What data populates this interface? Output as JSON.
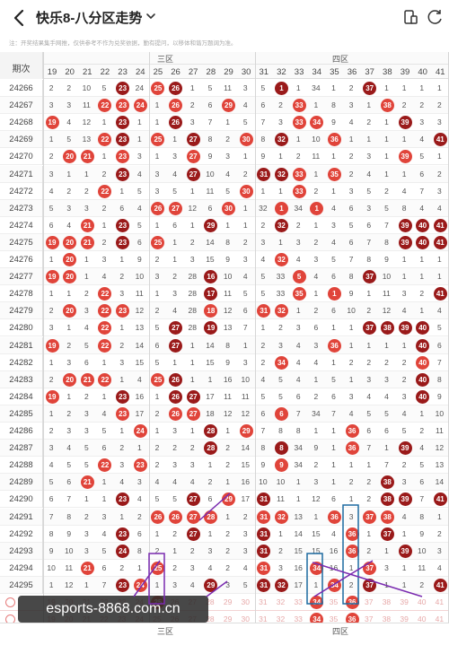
{
  "header": {
    "title": "快乐8-八分区走势",
    "back_icon": "chevron-left-icon",
    "dropdown_icon": "chevron-down-icon",
    "right_icons": [
      "device-icon",
      "share-icon"
    ]
  },
  "notice": "注：开奖结果集手网推，仅供参考不作为兑奖依据，勤有提问，以移体和谐万题阔为准。",
  "table": {
    "period_header": "期次",
    "zones": {
      "top_left": "三区",
      "top_right": "四区",
      "bottom_left": "三区",
      "bottom_right": "四区"
    },
    "columns": [
      "19",
      "20",
      "21",
      "22",
      "23",
      "24",
      "25",
      "26",
      "27",
      "28",
      "29",
      "30",
      "31",
      "32",
      "33",
      "34",
      "35",
      "36",
      "37",
      "38",
      "39",
      "40",
      "41"
    ],
    "rows": [
      {
        "p": "24266",
        "v": [
          "2",
          "2",
          "10",
          "5",
          "23",
          "24",
          "25",
          "26",
          "1",
          "5",
          "11",
          "3",
          "5",
          "1",
          "1",
          "34",
          "1",
          "2",
          "37",
          "1",
          "1",
          "1",
          "1"
        ],
        "b": [
          4,
          6,
          7,
          13,
          18
        ]
      },
      {
        "p": "24267",
        "v": [
          "3",
          "3",
          "11",
          "22",
          "23",
          "24",
          "1",
          "26",
          "2",
          "6",
          "29",
          "4",
          "6",
          "2",
          "33",
          "1",
          "8",
          "3",
          "1",
          "38",
          "2",
          "2",
          "2"
        ],
        "b": [
          3,
          4,
          5,
          7,
          10,
          14,
          19
        ]
      },
      {
        "p": "24268",
        "v": [
          "19",
          "4",
          "12",
          "1",
          "23",
          "1",
          "1",
          "26",
          "3",
          "7",
          "1",
          "5",
          "7",
          "3",
          "33",
          "34",
          "9",
          "4",
          "2",
          "1",
          "39",
          "3",
          "3"
        ],
        "b": [
          0,
          4,
          7,
          14,
          15,
          20
        ]
      },
      {
        "p": "24269",
        "v": [
          "1",
          "5",
          "13",
          "22",
          "23",
          "1",
          "25",
          "1",
          "27",
          "8",
          "2",
          "30",
          "8",
          "32",
          "1",
          "10",
          "36",
          "1",
          "1",
          "1",
          "1",
          "4",
          "41"
        ],
        "b": [
          3,
          4,
          6,
          8,
          11,
          13,
          16,
          22
        ]
      },
      {
        "p": "24270",
        "v": [
          "2",
          "20",
          "21",
          "1",
          "23",
          "3",
          "1",
          "3",
          "27",
          "9",
          "3",
          "1",
          "9",
          "1",
          "2",
          "11",
          "1",
          "2",
          "3",
          "1",
          "39",
          "5",
          "1"
        ],
        "b": [
          1,
          2,
          4,
          8,
          20
        ]
      },
      {
        "p": "24271",
        "v": [
          "3",
          "1",
          "1",
          "2",
          "23",
          "4",
          "3",
          "4",
          "27",
          "10",
          "4",
          "2",
          "31",
          "32",
          "33",
          "1",
          "35",
          "2",
          "4",
          "1",
          "1",
          "6",
          "2"
        ],
        "b": [
          4,
          8,
          12,
          13,
          14,
          16
        ]
      },
      {
        "p": "24272",
        "v": [
          "4",
          "2",
          "2",
          "22",
          "1",
          "5",
          "3",
          "5",
          "1",
          "11",
          "5",
          "30",
          "1",
          "1",
          "33",
          "2",
          "1",
          "3",
          "5",
          "2",
          "4",
          "7",
          "3"
        ],
        "b": [
          3,
          11,
          14
        ]
      },
      {
        "p": "24273",
        "v": [
          "5",
          "3",
          "3",
          "2",
          "6",
          "4",
          "26",
          "27",
          "12",
          "6",
          "30",
          "1",
          "32",
          "1",
          "34",
          "1",
          "4",
          "6",
          "3",
          "5",
          "8",
          "4",
          "4"
        ],
        "b": [
          6,
          7,
          10,
          13,
          15
        ]
      },
      {
        "p": "24274",
        "v": [
          "6",
          "4",
          "21",
          "1",
          "23",
          "5",
          "1",
          "6",
          "1",
          "29",
          "1",
          "1",
          "2",
          "32",
          "2",
          "1",
          "3",
          "5",
          "6",
          "7",
          "39",
          "40",
          "41"
        ],
        "b": [
          2,
          4,
          9,
          13,
          20,
          21,
          22
        ]
      },
      {
        "p": "24275",
        "v": [
          "19",
          "20",
          "21",
          "2",
          "23",
          "6",
          "25",
          "1",
          "2",
          "14",
          "8",
          "2",
          "3",
          "1",
          "3",
          "2",
          "4",
          "6",
          "7",
          "8",
          "39",
          "40",
          "41"
        ],
        "b": [
          0,
          1,
          2,
          4,
          6,
          20,
          21,
          22
        ]
      },
      {
        "p": "24276",
        "v": [
          "1",
          "20",
          "1",
          "3",
          "1",
          "9",
          "2",
          "1",
          "3",
          "15",
          "9",
          "3",
          "4",
          "32",
          "4",
          "3",
          "5",
          "7",
          "8",
          "9",
          "1",
          "1",
          "1"
        ],
        "b": [
          1,
          13
        ]
      },
      {
        "p": "24277",
        "v": [
          "19",
          "20",
          "1",
          "4",
          "2",
          "10",
          "3",
          "2",
          "28",
          "16",
          "10",
          "4",
          "5",
          "33",
          "5",
          "4",
          "6",
          "8",
          "37",
          "10",
          "1",
          "1",
          "1"
        ],
        "b": [
          0,
          1,
          9,
          14,
          18
        ]
      },
      {
        "p": "24278",
        "v": [
          "1",
          "1",
          "2",
          "22",
          "3",
          "11",
          "1",
          "3",
          "28",
          "17",
          "11",
          "5",
          "5",
          "33",
          "35",
          "1",
          "1",
          "9",
          "1",
          "11",
          "3",
          "2",
          "41"
        ],
        "b": [
          3,
          9,
          14,
          16,
          22
        ]
      },
      {
        "p": "24279",
        "v": [
          "2",
          "20",
          "3",
          "22",
          "23",
          "12",
          "2",
          "4",
          "28",
          "18",
          "12",
          "6",
          "31",
          "32",
          "1",
          "2",
          "6",
          "10",
          "2",
          "12",
          "4",
          "1",
          "4"
        ],
        "b": [
          1,
          3,
          4,
          9,
          12,
          13
        ]
      },
      {
        "p": "24280",
        "v": [
          "3",
          "1",
          "4",
          "22",
          "1",
          "13",
          "5",
          "27",
          "28",
          "19",
          "13",
          "7",
          "1",
          "2",
          "3",
          "6",
          "1",
          "1",
          "37",
          "38",
          "39",
          "40",
          "5"
        ],
        "b": [
          3,
          7,
          9,
          18,
          19,
          20,
          21
        ]
      },
      {
        "p": "24281",
        "v": [
          "19",
          "2",
          "5",
          "22",
          "2",
          "14",
          "6",
          "27",
          "1",
          "14",
          "8",
          "1",
          "2",
          "3",
          "4",
          "3",
          "36",
          "1",
          "1",
          "1",
          "1",
          "40",
          "6"
        ],
        "b": [
          0,
          3,
          7,
          16,
          21
        ]
      },
      {
        "p": "24282",
        "v": [
          "1",
          "3",
          "6",
          "1",
          "3",
          "15",
          "5",
          "1",
          "1",
          "15",
          "9",
          "3",
          "2",
          "34",
          "4",
          "4",
          "1",
          "2",
          "2",
          "2",
          "2",
          "40",
          "7"
        ],
        "b": [
          13,
          21
        ]
      },
      {
        "p": "24283",
        "v": [
          "2",
          "20",
          "21",
          "22",
          "1",
          "4",
          "25",
          "26",
          "1",
          "1",
          "16",
          "10",
          "4",
          "5",
          "4",
          "1",
          "5",
          "1",
          "3",
          "3",
          "2",
          "40",
          "8"
        ],
        "b": [
          1,
          2,
          3,
          6,
          7,
          21
        ]
      },
      {
        "p": "24284",
        "v": [
          "19",
          "1",
          "2",
          "1",
          "23",
          "16",
          "1",
          "26",
          "27",
          "17",
          "11",
          "11",
          "5",
          "5",
          "6",
          "2",
          "6",
          "3",
          "4",
          "4",
          "3",
          "40",
          "9"
        ],
        "b": [
          0,
          4,
          7,
          8,
          21
        ]
      },
      {
        "p": "24285",
        "v": [
          "1",
          "2",
          "3",
          "4",
          "23",
          "17",
          "2",
          "26",
          "27",
          "18",
          "12",
          "12",
          "6",
          "6",
          "7",
          "34",
          "7",
          "4",
          "5",
          "5",
          "4",
          "1",
          "10"
        ],
        "b": [
          4,
          7,
          8,
          13
        ]
      },
      {
        "p": "24286",
        "v": [
          "2",
          "3",
          "3",
          "5",
          "1",
          "24",
          "1",
          "3",
          "1",
          "28",
          "1",
          "29",
          "7",
          "8",
          "8",
          "1",
          "1",
          "36",
          "6",
          "6",
          "5",
          "2",
          "11"
        ],
        "b": [
          5,
          9,
          11,
          17
        ]
      },
      {
        "p": "24287",
        "v": [
          "3",
          "4",
          "5",
          "6",
          "2",
          "1",
          "2",
          "2",
          "2",
          "28",
          "2",
          "14",
          "8",
          "8",
          "34",
          "9",
          "1",
          "36",
          "7",
          "1",
          "39",
          "4",
          "12"
        ],
        "b": [
          9,
          13,
          17,
          20
        ]
      },
      {
        "p": "24288",
        "v": [
          "4",
          "5",
          "5",
          "22",
          "3",
          "23",
          "2",
          "3",
          "3",
          "1",
          "2",
          "15",
          "9",
          "9",
          "34",
          "2",
          "1",
          "1",
          "1",
          "7",
          "2",
          "5",
          "13"
        ],
        "b": [
          3,
          5,
          13
        ]
      },
      {
        "p": "24289",
        "v": [
          "5",
          "6",
          "21",
          "1",
          "4",
          "3",
          "4",
          "4",
          "4",
          "2",
          "1",
          "16",
          "10",
          "10",
          "1",
          "3",
          "1",
          "2",
          "2",
          "38",
          "3",
          "6",
          "14"
        ],
        "b": [
          2,
          19
        ]
      },
      {
        "p": "24290",
        "v": [
          "6",
          "7",
          "1",
          "1",
          "23",
          "4",
          "5",
          "5",
          "27",
          "6",
          "29",
          "17",
          "31",
          "11",
          "1",
          "12",
          "6",
          "1",
          "2",
          "38",
          "39",
          "7",
          "41"
        ],
        "b": [
          4,
          8,
          10,
          12,
          19,
          20,
          22
        ]
      },
      {
        "p": "24291",
        "v": [
          "7",
          "8",
          "2",
          "3",
          "1",
          "2",
          "26",
          "26",
          "27",
          "28",
          "1",
          "2",
          "31",
          "32",
          "13",
          "1",
          "36",
          "3",
          "37",
          "38",
          "4",
          "8",
          "1"
        ],
        "b": [
          6,
          7,
          8,
          9,
          12,
          13,
          16,
          18,
          19
        ]
      },
      {
        "p": "24292",
        "v": [
          "8",
          "9",
          "3",
          "4",
          "23",
          "6",
          "1",
          "2",
          "27",
          "1",
          "2",
          "3",
          "31",
          "1",
          "14",
          "15",
          "4",
          "36",
          "1",
          "37",
          "1",
          "9",
          "2"
        ],
        "b": [
          4,
          8,
          12,
          17,
          19
        ]
      },
      {
        "p": "24293",
        "v": [
          "9",
          "10",
          "3",
          "5",
          "24",
          "8",
          "2",
          "1",
          "2",
          "3",
          "2",
          "3",
          "31",
          "2",
          "15",
          "15",
          "16",
          "36",
          "2",
          "1",
          "39",
          "10",
          "3"
        ],
        "b": [
          4,
          12,
          17,
          20
        ]
      },
      {
        "p": "24294",
        "v": [
          "10",
          "11",
          "21",
          "6",
          "2",
          "1",
          "25",
          "2",
          "3",
          "4",
          "2",
          "4",
          "31",
          "3",
          "16",
          "34",
          "16",
          "1",
          "37",
          "3",
          "1",
          "11",
          "4"
        ],
        "b": [
          2,
          6,
          12,
          15,
          18
        ]
      },
      {
        "p": "24295",
        "v": [
          "1",
          "12",
          "1",
          "7",
          "23",
          "24",
          "1",
          "3",
          "4",
          "29",
          "3",
          "5",
          "31",
          "32",
          "17",
          "1",
          "34",
          "2",
          "37",
          "1",
          "1",
          "2",
          "41"
        ],
        "b": [
          4,
          5,
          9,
          12,
          13,
          16,
          18,
          22
        ]
      }
    ],
    "placeholder_rows": [
      {
        "v": [
          "19",
          "20",
          "21",
          "22",
          "23",
          "24",
          "25",
          "26",
          "27",
          "28",
          "29",
          "30",
          "31",
          "32",
          "33",
          "34",
          "35",
          "36",
          "37",
          "38",
          "39",
          "40",
          "41"
        ],
        "b": [
          6,
          15,
          17
        ]
      },
      {
        "v": [
          "19",
          "20",
          "21",
          "22",
          "23",
          "24",
          "25",
          "26",
          "27",
          "28",
          "29",
          "30",
          "31",
          "32",
          "33",
          "34",
          "35",
          "36",
          "37",
          "38",
          "39",
          "40",
          "41"
        ],
        "b": [
          15,
          17
        ]
      }
    ]
  },
  "watermark": "esports-8868.com.cn"
}
